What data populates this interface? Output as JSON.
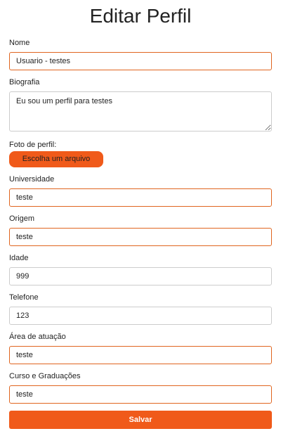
{
  "page": {
    "title": "Editar Perfil"
  },
  "form": {
    "nome": {
      "label": "Nome",
      "value": "Usuario - testes"
    },
    "biografia": {
      "label": "Biografia",
      "value": "Eu sou um perfil para testes"
    },
    "foto": {
      "label": "Foto de perfil:",
      "button_label": "Escolha um arquivo"
    },
    "universidade": {
      "label": "Universidade",
      "value": "teste"
    },
    "origem": {
      "label": "Origem",
      "value": "teste"
    },
    "idade": {
      "label": "Idade",
      "value": "999"
    },
    "telefone": {
      "label": "Telefone",
      "value": "123"
    },
    "area": {
      "label": "Área de atuação",
      "value": "teste"
    },
    "curso": {
      "label": "Curso e Graduações",
      "value": "teste"
    },
    "save_label": "Salvar"
  },
  "colors": {
    "accent": "#f05a1a",
    "accent_border": "#e0651f",
    "neutral_border": "#cccccc"
  }
}
